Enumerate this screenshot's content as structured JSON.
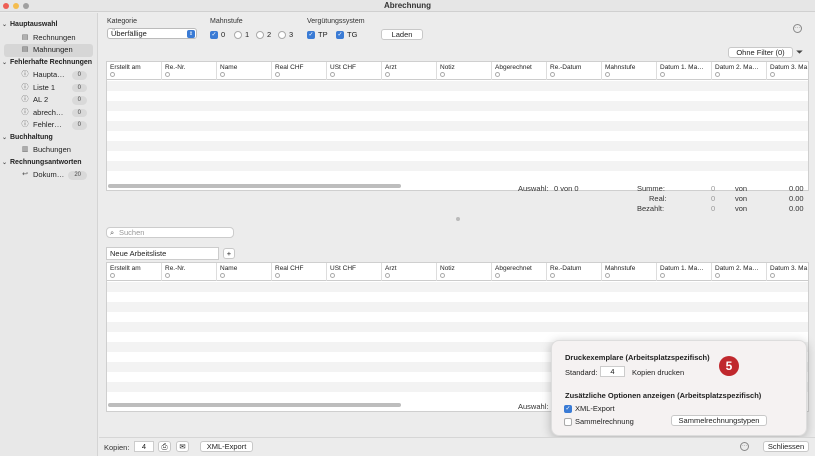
{
  "window": {
    "title": "Abrechnung",
    "colors": {
      "close": "#ee5e54",
      "min": "#f4bd4f",
      "max": "#a0a0a0"
    }
  },
  "sidebar": {
    "groups": [
      {
        "label": "Hauptauswahl",
        "items": [
          {
            "label": "Rechnungen",
            "icon": "document-icon",
            "badge": ""
          },
          {
            "label": "Mahnungen",
            "icon": "document-icon",
            "badge": "",
            "selected": true
          }
        ]
      },
      {
        "label": "Fehlerhafte Rechnungen",
        "items": [
          {
            "label": "Haupta…",
            "icon": "warning-icon",
            "badge": "0"
          },
          {
            "label": "Liste 1",
            "icon": "warning-icon",
            "badge": "0"
          },
          {
            "label": "AL 2",
            "icon": "warning-icon",
            "badge": "0"
          },
          {
            "label": "abrech…",
            "icon": "warning-icon",
            "badge": "0"
          },
          {
            "label": "Fehler…",
            "icon": "warning-icon",
            "badge": "0"
          }
        ]
      },
      {
        "label": "Buchhaltung",
        "items": [
          {
            "label": "Buchungen",
            "icon": "ledger-icon",
            "badge": ""
          }
        ]
      },
      {
        "label": "Rechnungsantworten",
        "items": [
          {
            "label": "Dokum…",
            "icon": "reply-icon",
            "badge": "20"
          }
        ]
      }
    ]
  },
  "filters": {
    "kategorie_label": "Kategorie",
    "kategorie_value": "Überfällige",
    "mahnstufe_label": "Mahnstufe",
    "mahnstufe": [
      {
        "label": "0",
        "checked": true
      },
      {
        "label": "1",
        "checked": false
      },
      {
        "label": "2",
        "checked": false
      },
      {
        "label": "3",
        "checked": false
      }
    ],
    "system_label": "Vergütungssystem",
    "system": [
      {
        "label": "TP",
        "checked": true
      },
      {
        "label": "TG",
        "checked": true
      }
    ],
    "laden": "Laden",
    "ohne_filter": "Ohne Filter (0)"
  },
  "columns": [
    "Erstellt am",
    "Re.-Nr.",
    "Name",
    "Real CHF",
    "USt CHF",
    "Arzt",
    "Notiz",
    "Abgerechnet",
    "Re.-Datum",
    "Mahnstufe",
    "Datum 1. Ma…",
    "Datum 2. Ma…",
    "Datum 3. Ma"
  ],
  "summary": {
    "auswahl_label": "Auswahl:",
    "auswahl_value": "0 von 0",
    "rows": [
      {
        "label": "Summe:",
        "a": "0",
        "von": "von",
        "b": "0.00"
      },
      {
        "label": "Real:",
        "a": "0",
        "von": "von",
        "b": "0.00"
      },
      {
        "label": "Bezahlt:",
        "a": "0",
        "von": "von",
        "b": "0.00"
      }
    ]
  },
  "lower": {
    "search_placeholder": "Suchen",
    "worklist": "Neue Arbeitsliste",
    "add": "+",
    "auswahl_label": "Auswahl:"
  },
  "popup": {
    "h1": "Druckexemplare (Arbeitsplatzspezifisch)",
    "standard_label": "Standard:",
    "standard_value": "4",
    "kopien": "Kopien drucken",
    "h2": "Zusätzliche Optionen anzeigen (Arbeitsplatzspezifisch)",
    "xml": "XML-Export",
    "sammel": "Sammelrechnung",
    "typen": "Sammelrechnungstypen",
    "step": "5"
  },
  "bottom": {
    "kopien_label": "Kopien:",
    "kopien_value": "4",
    "xml": "XML-Export",
    "schliessen": "Schliessen"
  }
}
